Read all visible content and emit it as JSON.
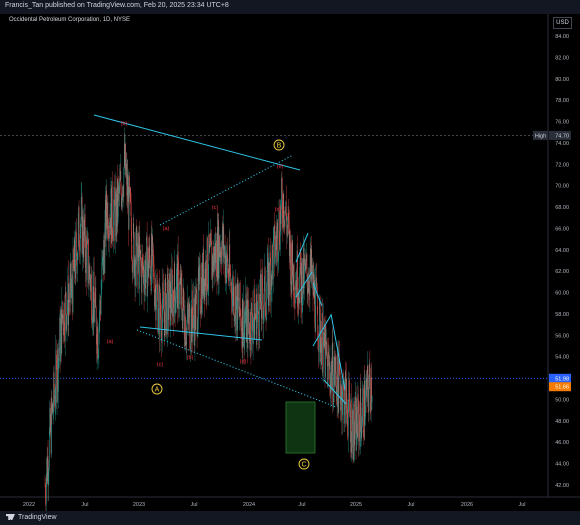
{
  "header": {
    "publish_line": "Francis_Tan published on TradingView.com, Feb 20, 2025 23:34 UTC+8"
  },
  "chart_data": {
    "type": "candlestick",
    "title": "Occidental Petroleum Corporation, 1D, NYSE",
    "currency": "USD",
    "ylim": [
      41,
      86
    ],
    "y_ticks": [
      42,
      44,
      46,
      48,
      50,
      52,
      54,
      56,
      58,
      60,
      62,
      64,
      66,
      68,
      70,
      72,
      74,
      76,
      78,
      80,
      82,
      84
    ],
    "x_ticks": [
      "2022",
      "Jul",
      "2023",
      "Jul",
      "2024",
      "Jul",
      "2025",
      "Jul",
      "2026",
      "Jul"
    ],
    "high_label": "High",
    "high_value": "74.70",
    "last_price": "51.98",
    "prev_price": "51.66",
    "approx_close_path": [
      [
        "2022-01",
        42
      ],
      [
        "2022-02",
        50
      ],
      [
        "2022-03",
        58
      ],
      [
        "2022-04",
        60
      ],
      [
        "2022-05",
        67
      ],
      [
        "2022-06",
        62
      ],
      [
        "2022-07",
        56
      ],
      [
        "2022-08",
        68
      ],
      [
        "2022-09",
        67
      ],
      [
        "2022-10",
        72
      ],
      [
        "2022-11",
        64
      ],
      [
        "2022-12",
        62
      ],
      [
        "2023-01",
        63
      ],
      [
        "2023-02",
        58
      ],
      [
        "2023-03",
        59
      ],
      [
        "2023-04",
        61
      ],
      [
        "2023-05",
        57
      ],
      [
        "2023-06",
        58
      ],
      [
        "2023-07",
        62
      ],
      [
        "2023-08",
        63
      ],
      [
        "2023-09",
        65
      ],
      [
        "2023-10",
        61
      ],
      [
        "2023-11",
        58
      ],
      [
        "2023-12",
        57
      ],
      [
        "2024-01",
        58
      ],
      [
        "2024-02",
        60
      ],
      [
        "2024-03",
        64
      ],
      [
        "2024-04",
        69
      ],
      [
        "2024-05",
        62
      ],
      [
        "2024-06",
        61
      ],
      [
        "2024-07",
        62
      ],
      [
        "2024-08",
        57
      ],
      [
        "2024-09",
        53
      ],
      [
        "2024-10",
        52
      ],
      [
        "2024-11",
        50
      ],
      [
        "2024-12",
        47
      ],
      [
        "2025-01",
        49
      ],
      [
        "2025-02",
        52
      ]
    ],
    "wave_labels": [
      "(b)",
      "(a)",
      "(c)",
      "(a)",
      "(b)",
      "(c)",
      "(d)",
      "(e)",
      "(d)"
    ],
    "circle_labels": [
      "A",
      "B",
      "C"
    ],
    "colors": {
      "up": "#26a69a",
      "down": "#ef5350",
      "trendline": "#2ec4e6",
      "wave_label": "#f23645",
      "circle_label": "#f5d142",
      "target_box": "#1b5e20",
      "last_price": "#2962ff",
      "prev_price": "#f57c00"
    }
  },
  "footer": {
    "brand": "TradingView"
  }
}
